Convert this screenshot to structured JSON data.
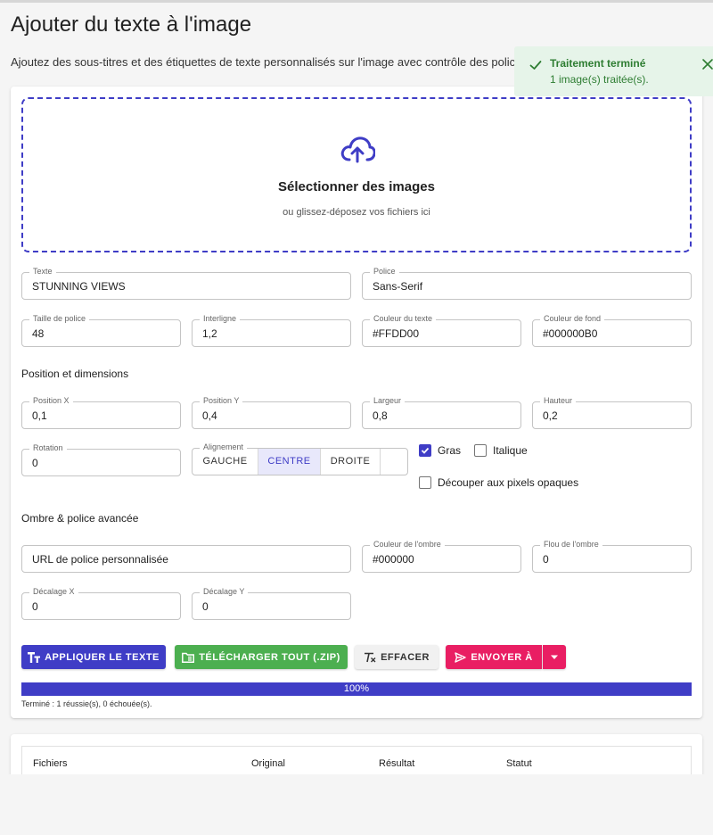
{
  "page": {
    "title": "Ajouter du texte à l'image",
    "description": "Ajoutez des sous-titres et des étiquettes de texte personnalisés sur l'image avec contrôle des polices"
  },
  "toast": {
    "title": "Traitement terminé",
    "message": "1 image(s) traitée(s)."
  },
  "dropzone": {
    "title": "Sélectionner des images",
    "subtitle": "ou glissez-déposez vos fichiers ici"
  },
  "text_fields": {
    "text": {
      "label": "Texte",
      "value": "STUNNING VIEWS"
    },
    "font": {
      "label": "Police",
      "value": "Sans-Serif"
    },
    "font_size": {
      "label": "Taille de police",
      "value": "48"
    },
    "line_height": {
      "label": "Interligne",
      "value": "1,2"
    },
    "text_color": {
      "label": "Couleur du texte",
      "value": "#FFDD00"
    },
    "bg_color": {
      "label": "Couleur de fond",
      "value": "#000000B0"
    }
  },
  "position": {
    "heading": "Position et dimensions",
    "x": {
      "label": "Position X",
      "value": "0,1"
    },
    "y": {
      "label": "Position Y",
      "value": "0,4"
    },
    "width": {
      "label": "Largeur",
      "value": "0,8"
    },
    "height": {
      "label": "Hauteur",
      "value": "0,2"
    },
    "rotation": {
      "label": "Rotation",
      "value": "0"
    },
    "alignment": {
      "label": "Alignement",
      "options": [
        "GAUCHE",
        "CENTRE",
        "DROITE"
      ],
      "selected": "CENTRE"
    },
    "bold": {
      "label": "Gras",
      "checked": true
    },
    "italic": {
      "label": "Italique",
      "checked": false
    },
    "clip": {
      "label": "Découper aux pixels opaques",
      "checked": false
    }
  },
  "advanced": {
    "heading": "Ombre & police avancée",
    "font_url": {
      "placeholder": "URL de police personnalisée",
      "value": ""
    },
    "shadow_color": {
      "label": "Couleur de l'ombre",
      "value": "#000000"
    },
    "shadow_blur": {
      "label": "Flou de l'ombre",
      "value": "0"
    },
    "offset_x": {
      "label": "Décalage X",
      "value": "0"
    },
    "offset_y": {
      "label": "Décalage Y",
      "value": "0"
    }
  },
  "actions": {
    "apply": "APPLIQUER LE TEXTE",
    "download": "TÉLÉCHARGER TOUT (.ZIP)",
    "clear": "EFFACER",
    "send": "ENVOYER À"
  },
  "progress": {
    "percent": 100,
    "label": "100%",
    "status": "Terminé : 1 réussie(s), 0 échouée(s)."
  },
  "table": {
    "columns": [
      "Fichiers",
      "Original",
      "Résultat",
      "Statut"
    ]
  },
  "colors": {
    "primary": "#3f3dc6",
    "success": "#4caf50",
    "accent": "#e91e63",
    "toast_bg": "#e6f4e9",
    "toast_text": "#2e7d32"
  },
  "icons": {
    "toast": "check-icon",
    "toast_close": "close-icon",
    "dropzone": "cloud-upload-icon",
    "apply": "text-format-icon",
    "download": "folder-zip-icon",
    "clear": "clear-format-icon",
    "send": "send-icon",
    "send_menu": "arrow-drop-down-icon"
  }
}
